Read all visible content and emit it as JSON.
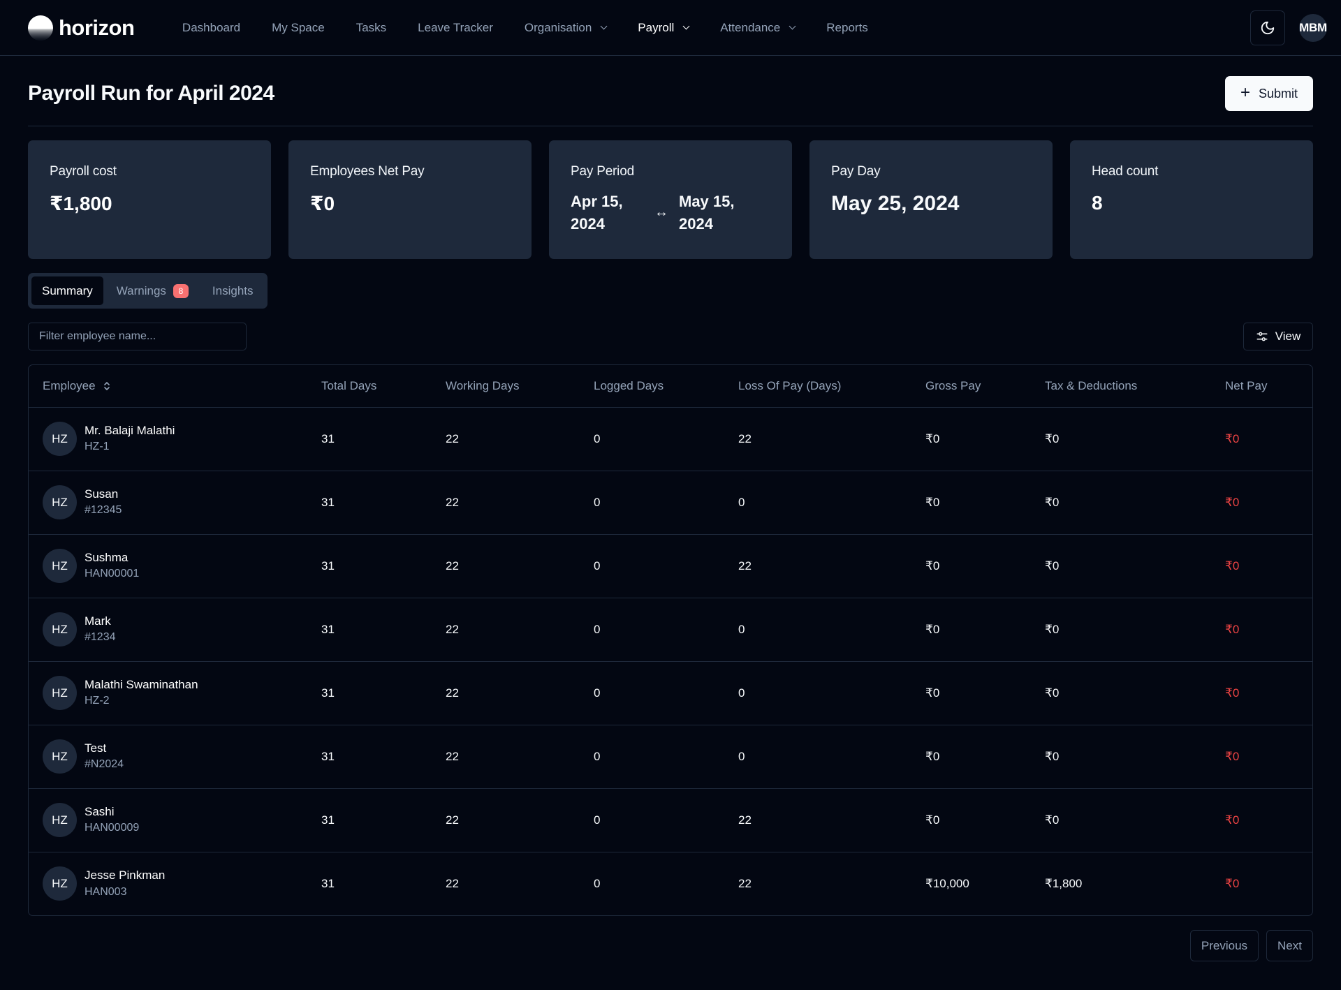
{
  "app": {
    "brand": "horizon",
    "user_initials": "MBM"
  },
  "nav": {
    "items": [
      {
        "label": "Dashboard"
      },
      {
        "label": "My Space"
      },
      {
        "label": "Tasks"
      },
      {
        "label": "Leave Tracker"
      },
      {
        "label": "Organisation"
      },
      {
        "label": "Payroll"
      },
      {
        "label": "Attendance"
      },
      {
        "label": "Reports"
      }
    ]
  },
  "page": {
    "title": "Payroll Run for April 2024",
    "submit_label": "Submit"
  },
  "cards": {
    "payroll_cost": {
      "label": "Payroll cost",
      "value": "₹1,800"
    },
    "net_pay": {
      "label": "Employees Net Pay",
      "value": "₹0"
    },
    "pay_period": {
      "label": "Pay Period",
      "start": "Apr 15, 2024",
      "end": "May 15, 2024",
      "arrow": "↔"
    },
    "pay_day": {
      "label": "Pay Day",
      "value": "May 25, 2024"
    },
    "head_count": {
      "label": "Head count",
      "value": "8"
    }
  },
  "tabs": [
    {
      "label": "Summary",
      "active": true
    },
    {
      "label": "Warnings",
      "badge": "8"
    },
    {
      "label": "Insights"
    }
  ],
  "filter": {
    "placeholder": "Filter employee name...",
    "view_label": "View"
  },
  "table": {
    "headers": [
      "Employee",
      "Total Days",
      "Working Days",
      "Logged Days",
      "Loss Of Pay (Days)",
      "Gross Pay",
      "Tax & Deductions",
      "Net Pay"
    ],
    "rows": [
      {
        "initials": "HZ",
        "name": "Mr. Balaji Malathi",
        "id": "HZ-1",
        "total": "31",
        "working": "22",
        "logged": "0",
        "lop": "22",
        "gross": "₹0",
        "tax": "₹0",
        "net": "₹0"
      },
      {
        "initials": "HZ",
        "name": "Susan",
        "id": "#12345",
        "total": "31",
        "working": "22",
        "logged": "0",
        "lop": "0",
        "gross": "₹0",
        "tax": "₹0",
        "net": "₹0"
      },
      {
        "initials": "HZ",
        "name": "Sushma",
        "id": "HAN00001",
        "total": "31",
        "working": "22",
        "logged": "0",
        "lop": "22",
        "gross": "₹0",
        "tax": "₹0",
        "net": "₹0"
      },
      {
        "initials": "HZ",
        "name": "Mark",
        "id": "#1234",
        "total": "31",
        "working": "22",
        "logged": "0",
        "lop": "0",
        "gross": "₹0",
        "tax": "₹0",
        "net": "₹0"
      },
      {
        "initials": "HZ",
        "name": "Malathi Swaminathan",
        "id": "HZ-2",
        "total": "31",
        "working": "22",
        "logged": "0",
        "lop": "0",
        "gross": "₹0",
        "tax": "₹0",
        "net": "₹0"
      },
      {
        "initials": "HZ",
        "name": "Test",
        "id": "#N2024",
        "total": "31",
        "working": "22",
        "logged": "0",
        "lop": "0",
        "gross": "₹0",
        "tax": "₹0",
        "net": "₹0"
      },
      {
        "initials": "HZ",
        "name": "Sashi",
        "id": "HAN00009",
        "total": "31",
        "working": "22",
        "logged": "0",
        "lop": "22",
        "gross": "₹0",
        "tax": "₹0",
        "net": "₹0"
      },
      {
        "initials": "HZ",
        "name": "Jesse Pinkman",
        "id": "HAN003",
        "total": "31",
        "working": "22",
        "logged": "0",
        "lop": "22",
        "gross": "₹10,000",
        "tax": "₹1,800",
        "net": "₹0"
      }
    ]
  },
  "pagination": {
    "previous": "Previous",
    "next": "Next"
  },
  "colors": {
    "background": "#030712",
    "card": "#1e293b",
    "net_pay": "#ef4444",
    "badge": "#f87171"
  }
}
